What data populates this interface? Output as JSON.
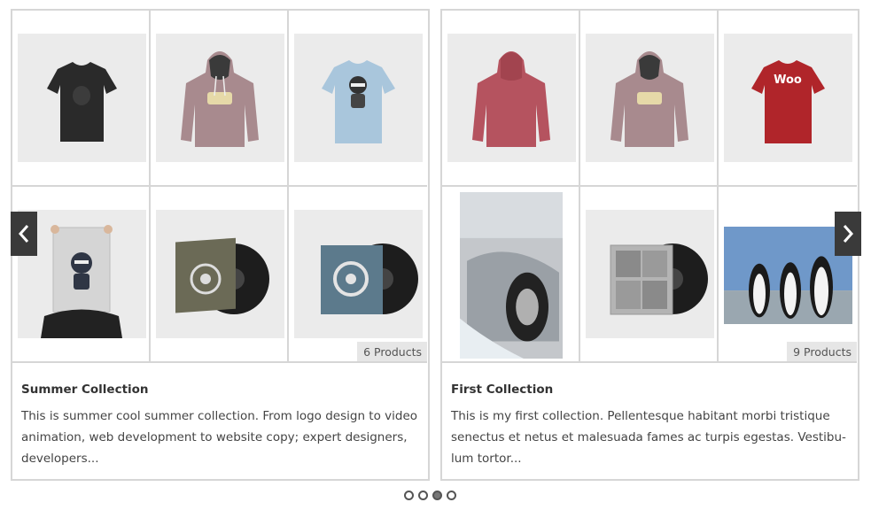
{
  "collections": [
    {
      "title": "Summer Collection",
      "count_label": "6 Products",
      "description": "This is summer cool summer collection. From logo design to video animation, web development to website copy; expert designers, developers...",
      "items": [
        {
          "icon": "black-tshirt-icon",
          "color": "#2a2a2a"
        },
        {
          "icon": "mauve-hoodie-icon",
          "color": "#a88a8e"
        },
        {
          "icon": "lightblue-tshirt-icon",
          "color": "#a9c6dc"
        },
        {
          "icon": "ninja-poster-icon",
          "color": "#d5d5d5"
        },
        {
          "icon": "vinyl-album-icon",
          "color": "#6b6a56"
        },
        {
          "icon": "vinyl-album-icon",
          "color": "#5c7a8c"
        }
      ]
    },
    {
      "title": "First Collection",
      "count_label": "9 Products",
      "description": "This is my first collection. Pellentesque habitant morbi tristique senectus et netus et malesuada fames ac turpis egestas. Vestibu-lum tortor...",
      "items": [
        {
          "icon": "red-hoodie-icon",
          "color": "#b5535f"
        },
        {
          "icon": "mauve-hoodie-icon",
          "color": "#a88a8e"
        },
        {
          "icon": "woo-tshirt-icon",
          "color": "#b0252a",
          "label": "Woo"
        },
        {
          "icon": "sports-car-photo-icon",
          "color": "#c4c7cb"
        },
        {
          "icon": "vinyl-album-icon",
          "color": "#b4b4b4"
        },
        {
          "icon": "penguins-photo-icon",
          "color": "#6f98c9"
        }
      ]
    }
  ],
  "pagination": {
    "pages": 4,
    "active_index": 2
  }
}
